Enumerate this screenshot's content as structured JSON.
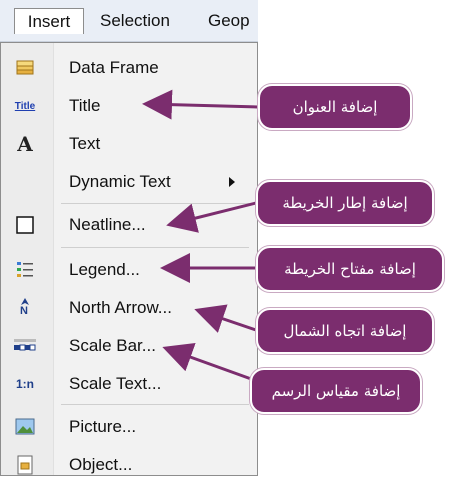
{
  "menubar": {
    "items": [
      {
        "label": "Insert"
      },
      {
        "label": "Selection"
      },
      {
        "label": "Geop"
      }
    ]
  },
  "menu": {
    "items": [
      {
        "label": "Data Frame",
        "icon": "data-frame-icon"
      },
      {
        "label": "Title",
        "icon": "title-icon",
        "icon_text": "Title"
      },
      {
        "label": "Text",
        "icon": "text-icon",
        "icon_text": "A"
      },
      {
        "label": "Dynamic Text",
        "icon": "none"
      },
      {
        "label": "Neatline...",
        "icon": "neatline-icon"
      },
      {
        "label": "Legend...",
        "icon": "legend-icon"
      },
      {
        "label": "North Arrow...",
        "icon": "north-arrow-icon",
        "icon_text": "N"
      },
      {
        "label": "Scale Bar...",
        "icon": "scale-bar-icon"
      },
      {
        "label": "Scale Text...",
        "icon": "scale-text-icon",
        "icon_text": "1:n"
      },
      {
        "label": "Picture...",
        "icon": "picture-icon"
      },
      {
        "label": "Object...",
        "icon": "object-icon"
      }
    ]
  },
  "callouts": {
    "title": "إضافة العنوان",
    "neatline": "إضافة إطار الخريطة",
    "legend": "إضافة مفتاح الخريطة",
    "north_arrow": "إضافة اتجاه الشمال",
    "scale_bar": "إضافة مقياس الرسم"
  },
  "colors": {
    "callout": "#7b2d6e",
    "menu_bg": "#f2f2f2",
    "menubar_bg": "#e9eef6"
  }
}
